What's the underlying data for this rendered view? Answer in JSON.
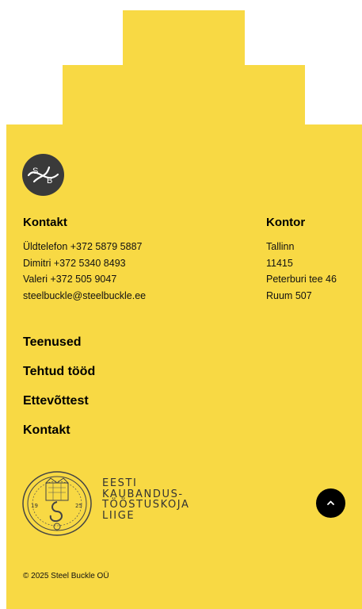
{
  "logo": {
    "letters": [
      "S",
      "B"
    ],
    "icon": "sb-logo-icon"
  },
  "contact": {
    "title": "Kontakt",
    "lines": [
      "Üldtelefon +372 5879 5887",
      "Dimitri +372 5340 8493",
      "Valeri +372 505 9047",
      "steelbuckle@steelbuckle.ee"
    ]
  },
  "office": {
    "title": "Kontor",
    "lines": [
      "Tallinn",
      "11415",
      "Peterburi tee 46",
      "Ruum 507"
    ]
  },
  "nav": {
    "items": [
      "Teenused",
      "Tehtud tööd",
      "Ettevõttest",
      "Kontakt"
    ]
  },
  "chamber": {
    "lines": [
      "EESTI",
      "KAUBANDUS-",
      "TÖÖSTUSKOJA",
      "LIIGE"
    ],
    "seal_years": [
      "19",
      "25"
    ],
    "icon": "chamber-seal-icon"
  },
  "scroll_top": {
    "icon": "chevron-up-icon"
  },
  "copyright": "© 2025 Steel Buckle OÜ",
  "colors": {
    "background": "#f8d944",
    "text": "#111111",
    "button": "#000000",
    "logo_bg": "#3a3a3a"
  }
}
